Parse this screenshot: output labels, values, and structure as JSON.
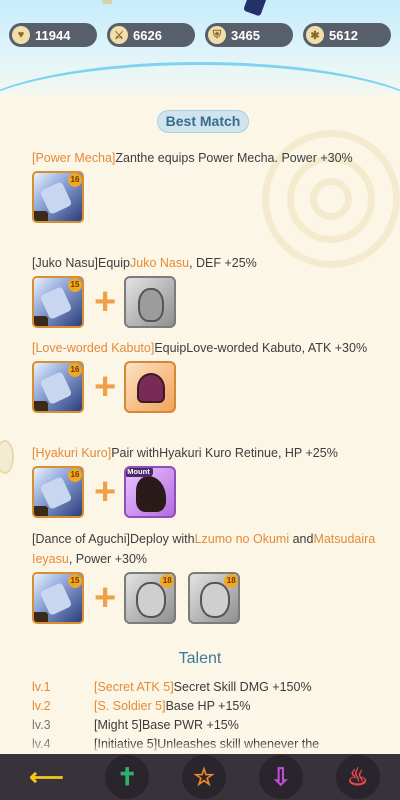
{
  "resources": [
    {
      "icon": "heart-icon",
      "value": "11944"
    },
    {
      "icon": "crossed-swords-icon",
      "value": "6626"
    },
    {
      "icon": "shield-icon",
      "value": "3465"
    },
    {
      "icon": "star-icon",
      "value": "5612"
    }
  ],
  "best_match_label": "Best Match",
  "combos": [
    {
      "prefix": "[Power Mecha]",
      "text": "Zanthe equips Power Mecha. Power +30%",
      "hero_level": "16"
    },
    {
      "prefix": "[Juko Nasu]",
      "pre": "Equip",
      "hl": "Juko Nasu",
      "post": ",  DEF +25%",
      "hero_level": "15"
    },
    {
      "prefix": "[Love-worded Kabuto]",
      "text": "EquipLove-worded Kabuto,  ATK +30%",
      "hero_level": "16"
    },
    {
      "prefix": "[Hyakuri Kuro]",
      "text": "Pair withHyakuri Kuro Retinue, HP +25%",
      "hero_level": "16",
      "mount_label": "Mount"
    },
    {
      "prefix": "[Dance of Aguchi]",
      "pre": "Deploy with",
      "hl1": "Lzumo no Okumi",
      "mid": " and",
      "hl2": "Matsudaira Ieyasu",
      "post": ", Power +30%",
      "hero_level": "15",
      "partner1_level": "18",
      "partner2_level": "18"
    }
  ],
  "talent_title": "Talent",
  "talents": [
    {
      "lv": "lv.1",
      "name": "[Secret ATK 5]",
      "desc": "Secret Skill DMG +150%"
    },
    {
      "lv": "lv.2",
      "name": "[S. Soldier 5]",
      "desc": "Base HP +15%"
    },
    {
      "lv": "lv.3",
      "name": "[Might 5]",
      "desc": "Base PWR +15%"
    },
    {
      "lv": "lv.4",
      "name": "[Initiative 5]",
      "desc": "Unleashes skill whenever the"
    }
  ],
  "nav": [
    "back-arrow-icon",
    "sword-emblem-icon",
    "star-cube-icon",
    "download-tray-icon",
    "flame-icon"
  ],
  "colors": {
    "accent_orange": "#e48a3a",
    "nav_bg": "#38323a",
    "title_blue": "#346e8a"
  }
}
